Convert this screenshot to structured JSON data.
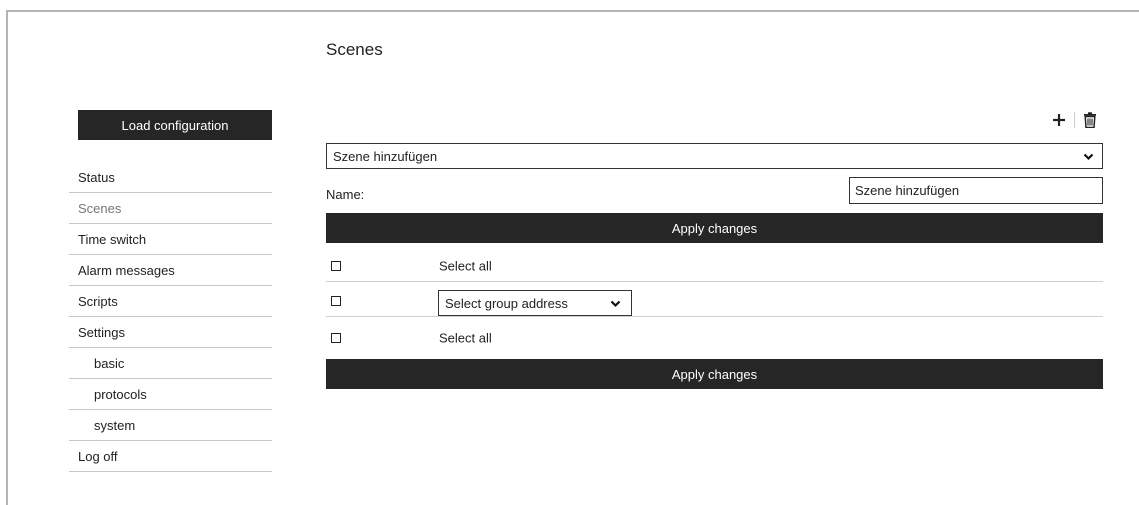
{
  "page": {
    "title": "Scenes"
  },
  "sidebar": {
    "load_button": "Load configuration",
    "items": [
      {
        "label": "Status"
      },
      {
        "label": "Scenes"
      },
      {
        "label": "Time switch"
      },
      {
        "label": "Alarm messages"
      },
      {
        "label": "Scripts"
      },
      {
        "label": "Settings"
      },
      {
        "label": "basic"
      },
      {
        "label": "protocols"
      },
      {
        "label": "system"
      },
      {
        "label": "Log off"
      }
    ],
    "active": "Scenes"
  },
  "toolbar": {
    "add_icon": "plus-icon",
    "delete_icon": "trash-icon"
  },
  "scene": {
    "selected": "Szene hinzufügen",
    "name_label": "Name:",
    "name_value": "Szene hinzufügen",
    "apply_label": "Apply changes"
  },
  "rows": [
    {
      "label": "Select all"
    },
    {
      "select_value": "Select group address"
    },
    {
      "label": "Select all"
    }
  ],
  "colors": {
    "button_bg": "#262626",
    "frame": "#b5b5b5"
  }
}
